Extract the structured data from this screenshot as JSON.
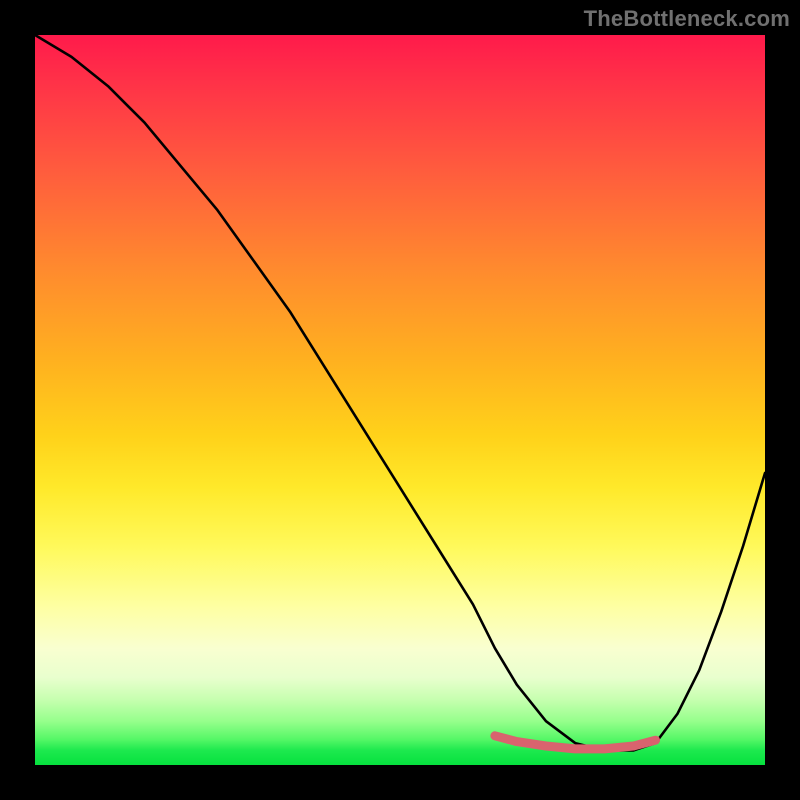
{
  "watermark": "TheBottleneck.com",
  "chart_data": {
    "type": "line",
    "title": "",
    "xlabel": "",
    "ylabel": "",
    "xlim": [
      0,
      100
    ],
    "ylim": [
      0,
      100
    ],
    "series": [
      {
        "name": "bottleneck-curve",
        "x": [
          0,
          5,
          10,
          15,
          20,
          25,
          30,
          35,
          40,
          45,
          50,
          55,
          60,
          63,
          66,
          70,
          74,
          78,
          82,
          85,
          88,
          91,
          94,
          97,
          100
        ],
        "values": [
          100,
          97,
          93,
          88,
          82,
          76,
          69,
          62,
          54,
          46,
          38,
          30,
          22,
          16,
          11,
          6,
          3,
          2,
          2,
          3,
          7,
          13,
          21,
          30,
          40
        ]
      },
      {
        "name": "optimal-band-marker",
        "x": [
          63,
          66,
          70,
          74,
          78,
          82,
          85
        ],
        "values": [
          4.0,
          3.2,
          2.6,
          2.2,
          2.2,
          2.6,
          3.4
        ]
      }
    ],
    "gradient_stops": [
      {
        "pos": 0,
        "color": "#ff1a4b"
      },
      {
        "pos": 0.18,
        "color": "#ff5a3e"
      },
      {
        "pos": 0.45,
        "color": "#ffd21a"
      },
      {
        "pos": 0.78,
        "color": "#feffa0"
      },
      {
        "pos": 0.94,
        "color": "#96ff8c"
      },
      {
        "pos": 1.0,
        "color": "#06e13e"
      }
    ]
  }
}
